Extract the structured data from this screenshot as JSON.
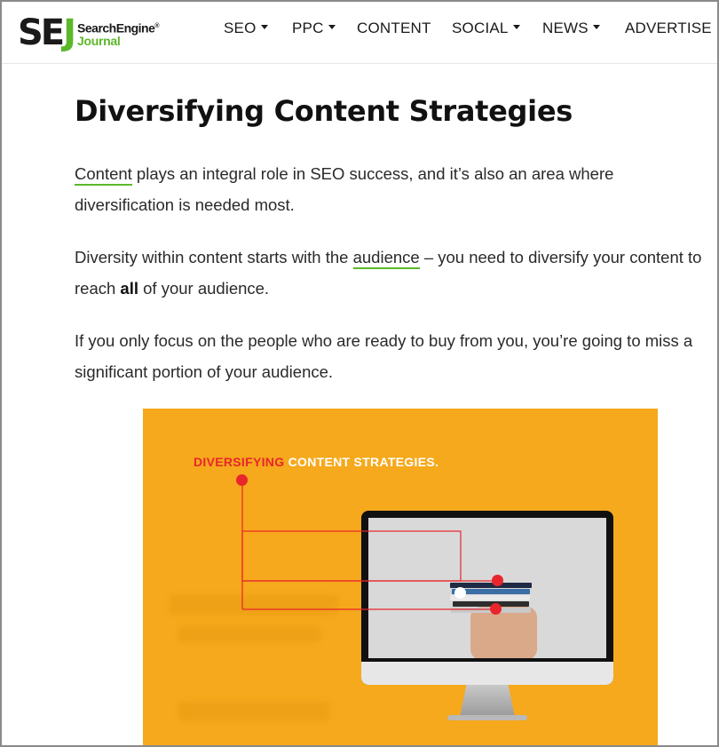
{
  "header": {
    "logo": {
      "mark_dark": "SE",
      "mark_green": "J",
      "word1": "SearchEngine",
      "word2": "Journal",
      "reg": "®"
    },
    "nav": [
      {
        "label": "SEO",
        "dropdown": true
      },
      {
        "label": "PPC",
        "dropdown": true
      },
      {
        "label": "CONTENT",
        "dropdown": false
      },
      {
        "label": "SOCIAL",
        "dropdown": true
      },
      {
        "label": "NEWS",
        "dropdown": true
      },
      {
        "label": "ADVERTISE",
        "dropdown": false
      }
    ]
  },
  "article": {
    "title": "Diversifying Content Strategies",
    "p1": {
      "link": "Content",
      "rest": " plays an integral role in SEO success, and it’s also an area where diversification is needed most."
    },
    "p2": {
      "before": "Diversity within content starts with the ",
      "link": "audience",
      "middle": " – you need to diversify your content to reach ",
      "bold": "all",
      "after": " of your audience."
    },
    "p3": {
      "text": "If you only focus on the people who are ready to buy from you, you’re going to miss a significant portion of your audience."
    }
  },
  "hero": {
    "title_red": "DIVERSIFYING",
    "title_white": " CONTENT STRATEGIES."
  },
  "colors": {
    "brand_green": "#5cb82b",
    "hero_orange": "#f6a91c",
    "accent_red": "#e8262b"
  }
}
